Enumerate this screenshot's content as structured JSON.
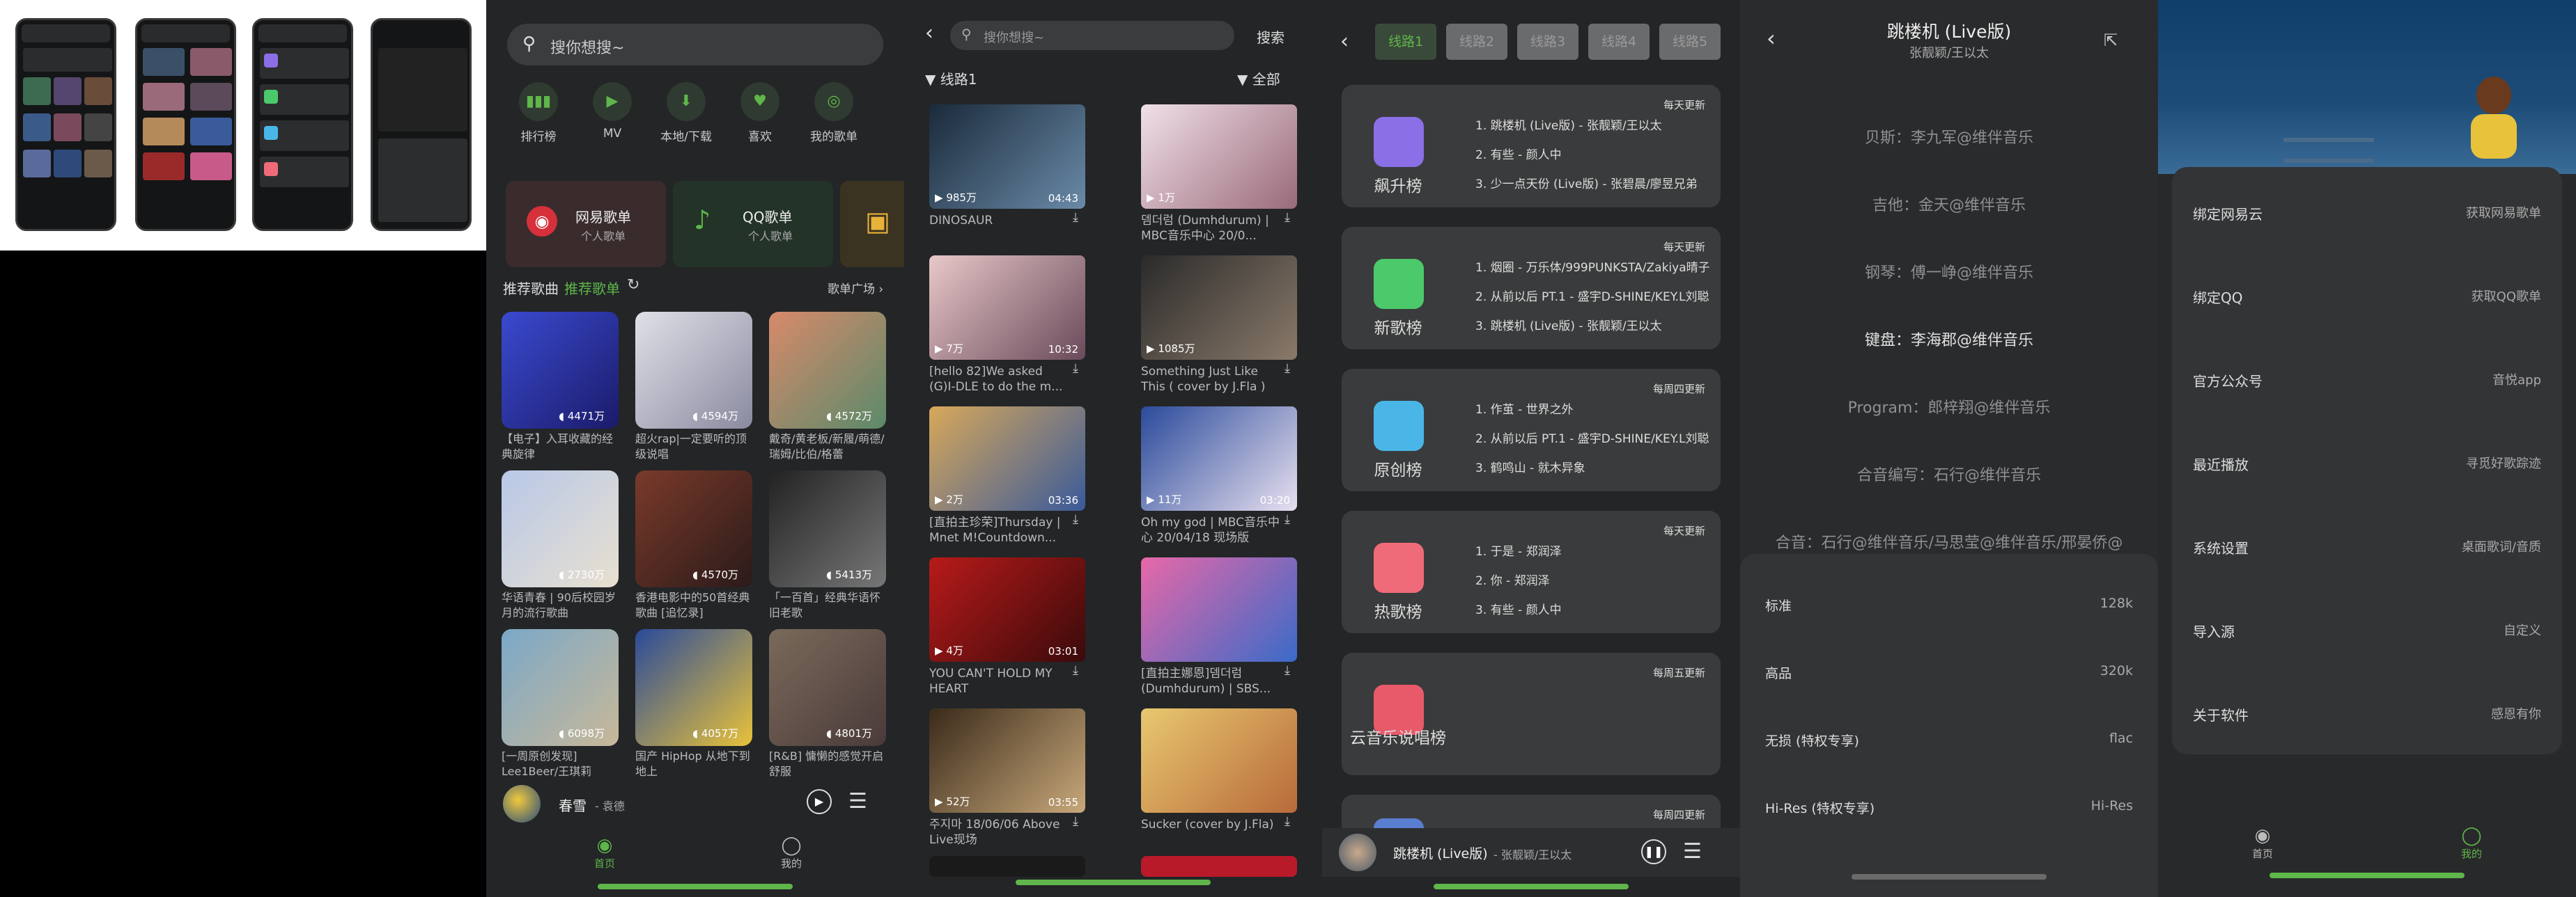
{
  "accent": "#5fb64a",
  "phone1": {
    "search_placeholder": "搜你想搜~",
    "shortcuts": [
      {
        "icon": "bar-chart-icon",
        "label": "排行榜"
      },
      {
        "icon": "video-icon",
        "label": "MV"
      },
      {
        "icon": "download-folder-icon",
        "label": "本地/下载"
      },
      {
        "icon": "heart-icon",
        "label": "喜欢"
      },
      {
        "icon": "disc-icon",
        "label": "我的歌单"
      }
    ],
    "sources": [
      {
        "title": "网易歌单",
        "sub": "个人歌单"
      },
      {
        "title": "QQ歌单",
        "sub": "个人歌单"
      }
    ],
    "section_label": "推荐歌曲",
    "section_active": "推荐歌单",
    "section_more": "歌单广场 ›",
    "playlists": [
      {
        "count": "4471万",
        "title": "【电子】入耳收藏的经典旋律"
      },
      {
        "count": "4594万",
        "title": "超火rap|一定要听的顶级说唱"
      },
      {
        "count": "4572万",
        "title": "戴奇/黄老板/新履/萌德/瑞姆/比伯/格蕾"
      },
      {
        "count": "2730万",
        "title": "华语青春 | 90后校园岁月的流行歌曲"
      },
      {
        "count": "4570万",
        "title": "香港电影中的50首经典歌曲 [追忆录]"
      },
      {
        "count": "5413万",
        "title": "「一百首」经典华语怀旧老歌"
      },
      {
        "count": "6098万",
        "title": "[一周原创发现] Lee1Beer/王琪莉"
      },
      {
        "count": "4057万",
        "title": "国产 HipHop 从地下到地上"
      },
      {
        "count": "4801万",
        "title": "[R&B] 慵懒的感觉开启舒服"
      }
    ],
    "mini_player": {
      "song": "春雪",
      "artist": "- 袁德"
    },
    "nav": [
      "首页",
      "我的"
    ]
  },
  "phone2": {
    "search_placeholder": "搜你想搜~",
    "search_button": "搜索",
    "filter_left": "线路1",
    "filter_right": "全部",
    "videos": [
      {
        "views": "985万",
        "dur": "04:43",
        "title": "DINOSAUR"
      },
      {
        "views": "1万",
        "dur": "",
        "title": "뎀더럼 (Dumhdurum) | MBC音乐中心 20/0..."
      },
      {
        "views": "7万",
        "dur": "10:32",
        "title": "[hello 82]We asked (G)I-DLE to do the m..."
      },
      {
        "views": "1085万",
        "dur": "",
        "title": "Something Just Like This ( cover by J.Fla )"
      },
      {
        "views": "2万",
        "dur": "03:36",
        "title": "[直拍主珍荣]Thursday | Mnet M!Countdown..."
      },
      {
        "views": "11万",
        "dur": "03:20",
        "title": "Oh my god | MBC音乐中心 20/04/18 现场版"
      },
      {
        "views": "4万",
        "dur": "03:01",
        "title": "YOU CAN'T HOLD MY HEART"
      },
      {
        "views": "",
        "dur": "",
        "title": "[直拍主娜恩]뎀더럼 (Dumhdurum) | SBS..."
      },
      {
        "views": "52万",
        "dur": "03:55",
        "title": "주지마 18/06/06 Above Live现场"
      },
      {
        "views": "",
        "dur": "",
        "title": "Sucker (cover by J.Fla)"
      }
    ]
  },
  "phone3": {
    "tabs": [
      "线路1",
      "线路2",
      "线路3",
      "线路4",
      "线路5"
    ],
    "charts": [
      {
        "name": "飙升榜",
        "update": "每天更新",
        "color": "#8a6fe6",
        "lines": [
          "1. 跳楼机 (Live版) - 张靓颖/王以太",
          "2. 有些 - 颜人中",
          "3. 少一点天份 (Live版) - 张碧晨/廖昱兄弟"
        ]
      },
      {
        "name": "新歌榜",
        "update": "每天更新",
        "color": "#4cc96a",
        "lines": [
          "1. 烟圈 - 万乐体/999PUNKSTA/Zakiya晴子",
          "2. 从前以后 PT.1 - 盛宇D-SHINE/KEY.L刘聪",
          "3. 跳楼机 (Live版) - 张靓颖/王以太"
        ]
      },
      {
        "name": "原创榜",
        "update": "每周四更新",
        "color": "#4ab6e8",
        "lines": [
          "1. 作茧 - 世界之外",
          "2. 从前以后 PT.1 - 盛宇D-SHINE/KEY.L刘聪",
          "3. 鹤鸣山 - 就木异象"
        ]
      },
      {
        "name": "热歌榜",
        "update": "每天更新",
        "color": "#f06b7a",
        "lines": [
          "1. 于是 - 郑润泽",
          "2. 你 - 郑润泽",
          "3. 有些 - 颜人中"
        ]
      },
      {
        "name": "云音乐说唱榜",
        "update": "每周五更新",
        "color": "#e85a6a",
        "lines": []
      },
      {
        "name": "",
        "update": "每周四更新",
        "color": "#5a7fd0",
        "lines": []
      }
    ],
    "player": {
      "song": "跳楼机 (Live版)",
      "artist": "- 张靓颖/王以太"
    }
  },
  "phone4": {
    "title": "跳楼机 (Live版)",
    "artist": "张靓颖/王以太",
    "credits": [
      "贝斯：李九军@维伴音乐",
      "吉他：金天@维伴音乐",
      "钢琴：傅一峥@维伴音乐",
      "键盘：李海郡@维伴音乐",
      "Program：郎梓翔@维伴音乐",
      "合音编写：石行@维伴音乐",
      "合音：石行@维伴音乐/马思莹@维伴音乐/邢晏侨@"
    ],
    "quality": [
      {
        "label": "标准",
        "value": "128k"
      },
      {
        "label": "高品",
        "value": "320k"
      },
      {
        "label": "无损 (特权专享)",
        "value": "flac"
      },
      {
        "label": "Hi-Res (特权专享)",
        "value": "Hi-Res"
      }
    ]
  },
  "phone5": {
    "rows": [
      {
        "label": "绑定网易云",
        "value": "获取网易歌单"
      },
      {
        "label": "绑定QQ",
        "value": "获取QQ歌单"
      },
      {
        "label": "官方公众号",
        "value": "音悦app"
      },
      {
        "label": "最近播放",
        "value": "寻觅好歌踪迹"
      },
      {
        "label": "系统设置",
        "value": "桌面歌词/音质"
      },
      {
        "label": "导入源",
        "value": "自定义"
      },
      {
        "label": "关于软件",
        "value": "感恩有你"
      }
    ],
    "nav": [
      "首页",
      "我的"
    ]
  }
}
